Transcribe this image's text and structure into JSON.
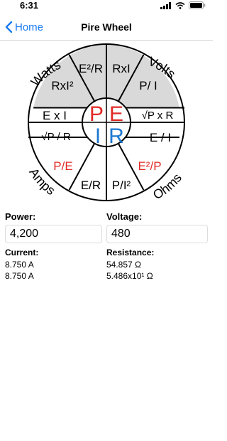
{
  "status": {
    "time": "6:31"
  },
  "nav": {
    "back_label": "Home",
    "title": "Pire Wheel"
  },
  "wheel": {
    "quadrants": {
      "top_left": "Watts",
      "top_right": "Volts",
      "bottom_left": "Amps",
      "bottom_right": "Ohms"
    },
    "center": {
      "P": "P",
      "E": "E",
      "I": "I",
      "R": "R"
    },
    "cells": {
      "w1": "E²/R",
      "w2": "RxI²",
      "w3": "E x I",
      "v1": "RxI",
      "v2": "P/ I",
      "v3": "√P x R",
      "o1": "E / I",
      "o2": "E²/P",
      "o3": "P/I²",
      "a1": "E/R",
      "a2": "P/E",
      "a3": "√P / R"
    },
    "colors": {
      "red": "#e12a26",
      "blue": "#1f78d1",
      "shade": "#d9d9d9"
    }
  },
  "power": {
    "label": "Power:",
    "value": "4,200"
  },
  "voltage": {
    "label": "Voltage:",
    "value": "480"
  },
  "current": {
    "label": "Current:",
    "value1": "8.750 A",
    "value2": "8.750 A"
  },
  "resistance": {
    "label": "Resistance:",
    "value1": "54.857 Ω",
    "value2": "5.486x10¹ Ω"
  }
}
